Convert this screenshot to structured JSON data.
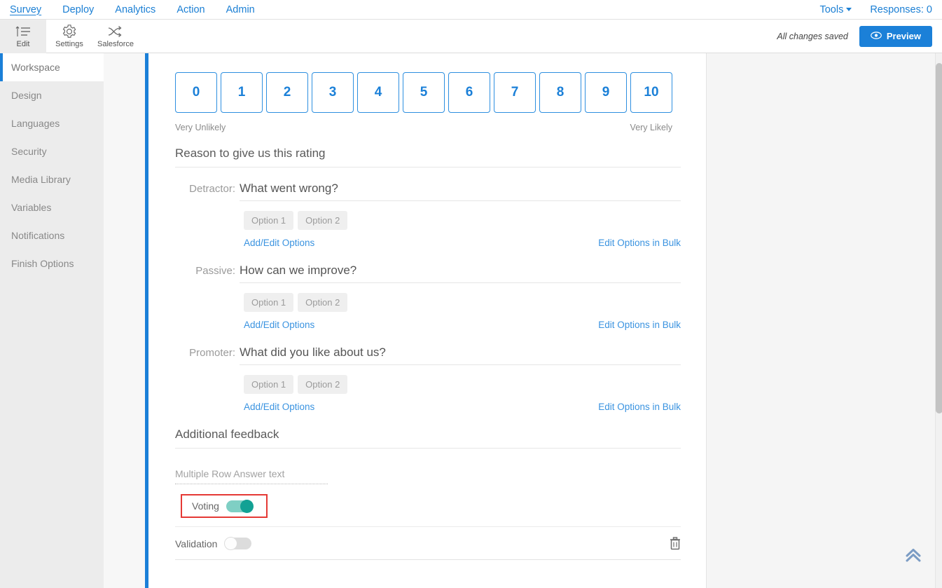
{
  "top_nav": {
    "items": [
      {
        "label": "Survey",
        "active": true
      },
      {
        "label": "Deploy",
        "active": false
      },
      {
        "label": "Analytics",
        "active": false
      },
      {
        "label": "Action",
        "active": false
      },
      {
        "label": "Admin",
        "active": false
      }
    ],
    "tools_label": "Tools",
    "responses_label": "Responses: 0"
  },
  "toolbar": {
    "buttons": [
      {
        "label": "Edit",
        "icon": "edit-icon",
        "active": true
      },
      {
        "label": "Settings",
        "icon": "gear-icon",
        "active": false
      },
      {
        "label": "Salesforce",
        "icon": "salesforce-icon",
        "active": false
      }
    ],
    "saved_status": "All changes saved",
    "preview_label": "Preview",
    "preview_icon": "eye-icon",
    "preview_color": "#1b80d8"
  },
  "sidebar": {
    "items": [
      {
        "label": "Workspace",
        "active": true
      },
      {
        "label": "Design",
        "active": false
      },
      {
        "label": "Languages",
        "active": false
      },
      {
        "label": "Security",
        "active": false
      },
      {
        "label": "Media Library",
        "active": false
      },
      {
        "label": "Variables",
        "active": false
      },
      {
        "label": "Notifications",
        "active": false
      },
      {
        "label": "Finish Options",
        "active": false
      }
    ],
    "active_accent": "#1b80d8"
  },
  "editor": {
    "nps": {
      "values": [
        "0",
        "1",
        "2",
        "3",
        "4",
        "5",
        "6",
        "7",
        "8",
        "9",
        "10"
      ],
      "left_label": "Very Unlikely",
      "right_label": "Very Likely",
      "box_color": "#1b80d8"
    },
    "reason_heading": "Reason to give us this rating",
    "groups": [
      {
        "label": "Detractor:",
        "question": "What went wrong?",
        "options": [
          "Option 1",
          "Option 2"
        ],
        "add_edit_link": "Add/Edit Options",
        "bulk_link": "Edit Options in Bulk"
      },
      {
        "label": "Passive:",
        "question": "How can we improve?",
        "options": [
          "Option 1",
          "Option 2"
        ],
        "add_edit_link": "Add/Edit Options",
        "bulk_link": "Edit Options in Bulk"
      },
      {
        "label": "Promoter:",
        "question": "What did you like about us?",
        "options": [
          "Option 1",
          "Option 2"
        ],
        "add_edit_link": "Add/Edit Options",
        "bulk_link": "Edit Options in Bulk"
      }
    ],
    "additional_feedback_heading": "Additional feedback",
    "multi_row_placeholder": "Multiple Row Answer text",
    "voting": {
      "label": "Voting",
      "state": "on",
      "highlight_color": "#e53935",
      "toggle_on_color": "#12a194"
    },
    "validation": {
      "label": "Validation",
      "state": "off"
    },
    "delete_icon": "trash-icon"
  },
  "right_pane": {
    "scroll_top_icon": "chevron-double-up-icon"
  }
}
